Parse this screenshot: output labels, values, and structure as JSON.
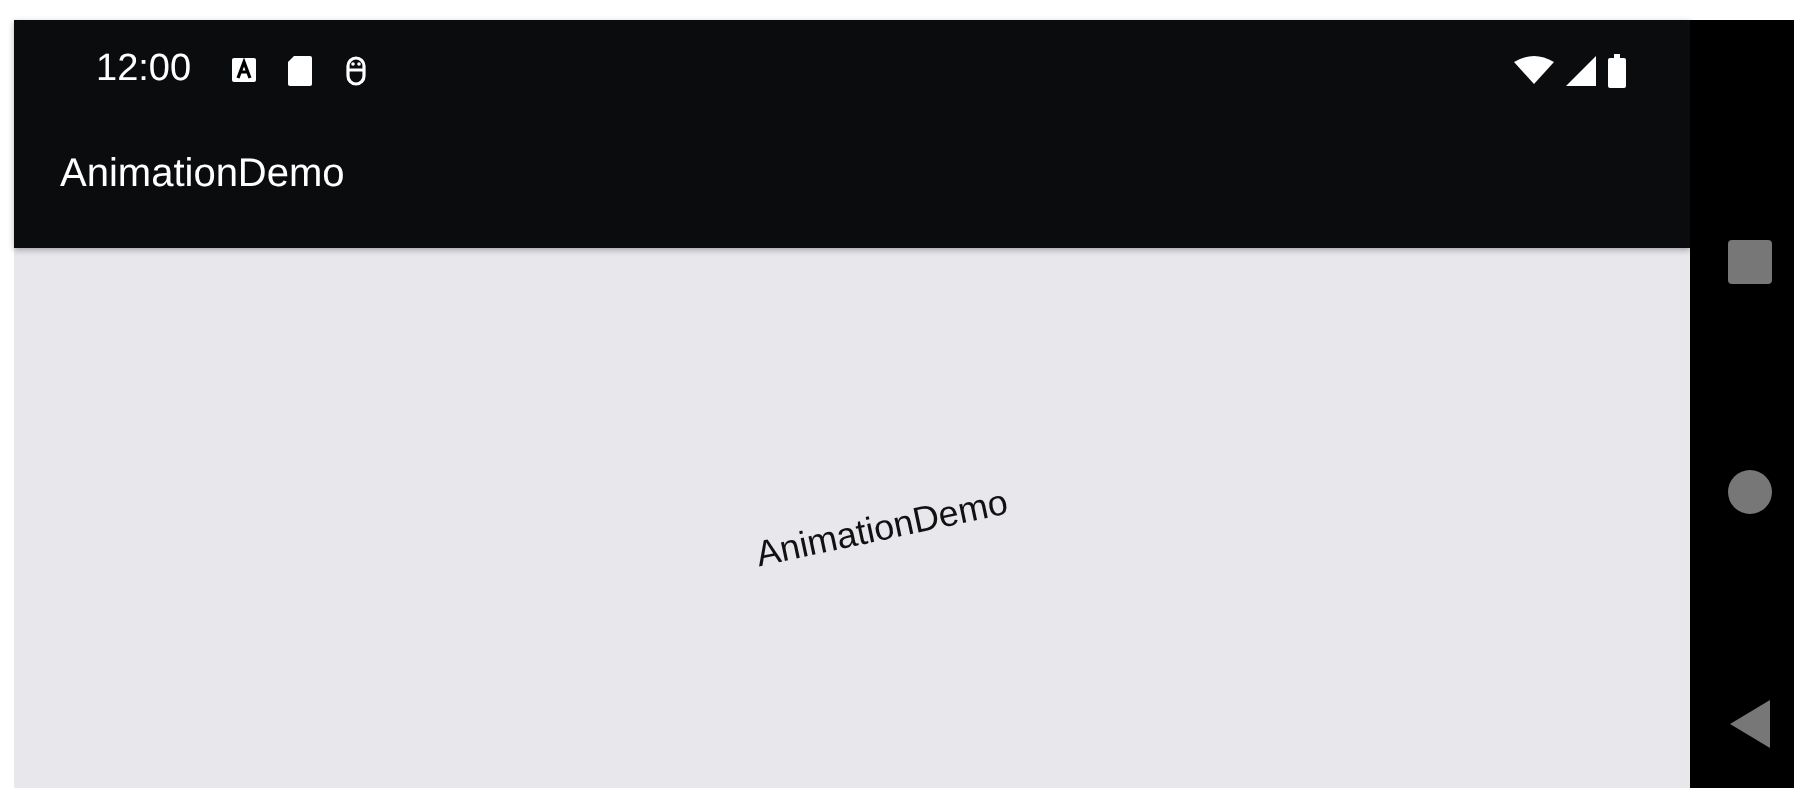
{
  "status_bar": {
    "time": "12:00"
  },
  "app_bar": {
    "title": "AnimationDemo"
  },
  "content": {
    "label": "AnimationDemo"
  }
}
